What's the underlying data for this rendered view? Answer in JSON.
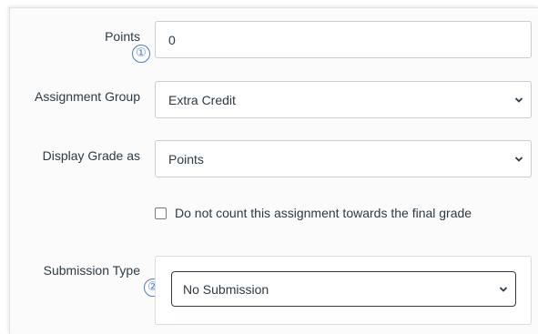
{
  "form": {
    "points": {
      "label": "Points",
      "value": "0",
      "marker": "①"
    },
    "assignment_group": {
      "label": "Assignment Group",
      "selected": "Extra Credit",
      "icon": "chevron-down-icon"
    },
    "display_grade": {
      "label": "Display Grade as",
      "selected": "Points",
      "icon": "chevron-down-icon"
    },
    "exclude_final_grade": {
      "label": "Do not count this assignment towards the final grade",
      "checked": false
    },
    "submission_type": {
      "label": "Submission Type",
      "selected": "No Submission",
      "marker": "②",
      "icon": "chevron-down-icon"
    }
  },
  "colors": {
    "text": "#2d3b45",
    "marker": "#4a7cc9",
    "border": "#c7cdd1"
  }
}
